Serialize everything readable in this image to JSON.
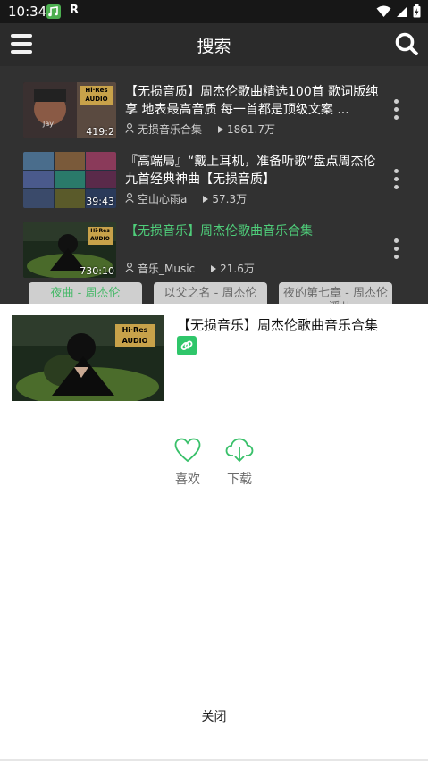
{
  "status_bar": {
    "time": "10:34",
    "extra_icon_text": "R"
  },
  "header": {
    "title": "搜索",
    "menu_icon": "hamburger-menu-icon",
    "search_icon": "search-icon"
  },
  "results": [
    {
      "title": "【无损音质】周杰伦歌曲精选100首 歌词版纯享 地表最高音质 每一首都是顶级文案 ...",
      "author": "无损音乐合集",
      "plays": "1861.7万",
      "duration": "419:2",
      "thumb_badge": "Hi·Res AUDIO",
      "thumb_caption": "Jay",
      "active": false
    },
    {
      "title": "『高端局』“戴上耳机，准备听歌”盘点周杰伦九首经典神曲【无损音质】",
      "author": "空山心雨a",
      "plays": "57.3万",
      "duration": "39:43",
      "thumb_badge": "",
      "thumb_caption": "",
      "active": false
    },
    {
      "title": "【无损音乐】周杰伦歌曲音乐合集",
      "author": "音乐_Music",
      "plays": "21.6万",
      "duration": "730:10",
      "thumb_badge": "Hi·Res AUDIO",
      "thumb_caption": "",
      "active": true
    }
  ],
  "chips": [
    {
      "label": "夜曲 - 周杰伦",
      "active": true
    },
    {
      "label": "以父之名 - 周杰伦",
      "active": false
    },
    {
      "label": "夜的第七章 - 周杰伦 _ 潘儿",
      "active": false
    }
  ],
  "sheet": {
    "title": "【无损音乐】周杰伦歌曲音乐合集",
    "thumb_badge": "Hi·Res AUDIO",
    "like_label": "喜欢",
    "download_label": "下载",
    "close_label": "关闭"
  },
  "colors": {
    "accent": "#2fc66a",
    "active_text": "#4fce7a"
  }
}
